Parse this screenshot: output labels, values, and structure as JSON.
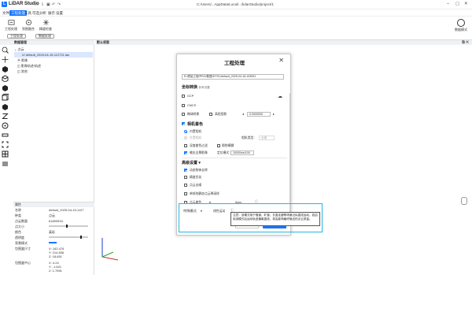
{
  "app": {
    "name": "LiDAR Studio",
    "logo_letter": "L",
    "path": "C:/Users/...AppData/Local/.../lidarStudio/project/1"
  },
  "titlebar_icons": [
    "folder-icon",
    "download-icon",
    "save-icon",
    "undo-icon",
    "redo-icon"
  ],
  "menu": [
    "文件",
    "工程处理",
    "工具",
    "可选分析",
    "展示",
    "设置"
  ],
  "menu_active": 1,
  "ribbon": {
    "buttons": [
      "工程处理",
      "到图融合",
      "精度检查"
    ],
    "pills": [
      "工程处理",
      "数据处理"
    ],
    "user_label": "数据模式"
  },
  "left_panel": {
    "title": "数据管理",
    "tree": [
      {
        "label": "点云",
        "level": 0
      },
      {
        "label": "default_2025-04-15-112721.las",
        "level": 1,
        "selected": true
      },
      {
        "label": "影像",
        "level": 0
      },
      {
        "label": "影像轨迹/轨迹",
        "level": 0
      },
      {
        "label": "其他",
        "level": 0
      }
    ]
  },
  "properties": {
    "title": "属性",
    "rows": [
      {
        "k": "名称",
        "v": "default_2025-04-15-1127"
      },
      {
        "k": "种类",
        "v": "点云"
      },
      {
        "k": "点云数量",
        "v": "61890534"
      },
      {
        "k": "点大小",
        "v": ""
      },
      {
        "k": "颜色",
        "v": "真彩"
      },
      {
        "k": "透明度",
        "v": ""
      },
      {
        "k": "背景模式",
        "v": ""
      },
      {
        "k": "包围盒尺寸",
        "v": "X: 162.476\nY: 214.836\nZ: 18.651"
      },
      {
        "k": "包围盒中心",
        "v": "X: 4.24\nY: -1.621\nZ: 1.7591"
      }
    ]
  },
  "viewport": {
    "title": "默认视窗"
  },
  "dialog": {
    "title": "工程处理",
    "path": "E:/原始工程/PRO/数据/DTS1/default_2025-04-16-193051",
    "sections": {
      "coord": {
        "title": "坐标转换",
        "sub": "参考设置"
      },
      "color": {
        "title": "相机着色"
      },
      "advanced": {
        "title": "高级设置"
      }
    },
    "coord_options": [
      {
        "label": "GCP",
        "checked": false
      },
      {
        "label": "CMCS",
        "checked": false
      },
      {
        "label": "椭球转换",
        "checked": false
      },
      {
        "label": "高程投影",
        "checked": false
      }
    ],
    "coord_value": "0.0000000",
    "color_options": {
      "internal_camera": "内置相机",
      "external_camera": "外置相机",
      "camera_type_label": "相机类型：",
      "camera_type_value": "全景",
      "depth_filter": "深度着色过滤",
      "remove_blur": "剔除模糊",
      "output_images": "输出全景影像",
      "location_mode": "定位模式：",
      "location_value": "10000ms/100"
    },
    "advanced_options": [
      {
        "label": "动态物体去除",
        "checked": true
      },
      {
        "label": "精度优化",
        "checked": false
      },
      {
        "label": "点云去噪",
        "checked": false
      },
      {
        "label": "单帧的静态点云降采样",
        "checked": false
      },
      {
        "label": "点云着色",
        "checked": false
      }
    ],
    "advanced_select": "5mm",
    "special_mode_label": "特殊模式",
    "special_mode_value": "线性运动",
    "tooltip": "注意：该模式用于隧道、矿道、长直走廊等场景近似直线运动，若启用该模式后运动轨迹偏离直线，将会影响最终输出的点云质量。"
  },
  "colors": {
    "accent": "#1677ff",
    "highlight": "#25b6e3"
  }
}
